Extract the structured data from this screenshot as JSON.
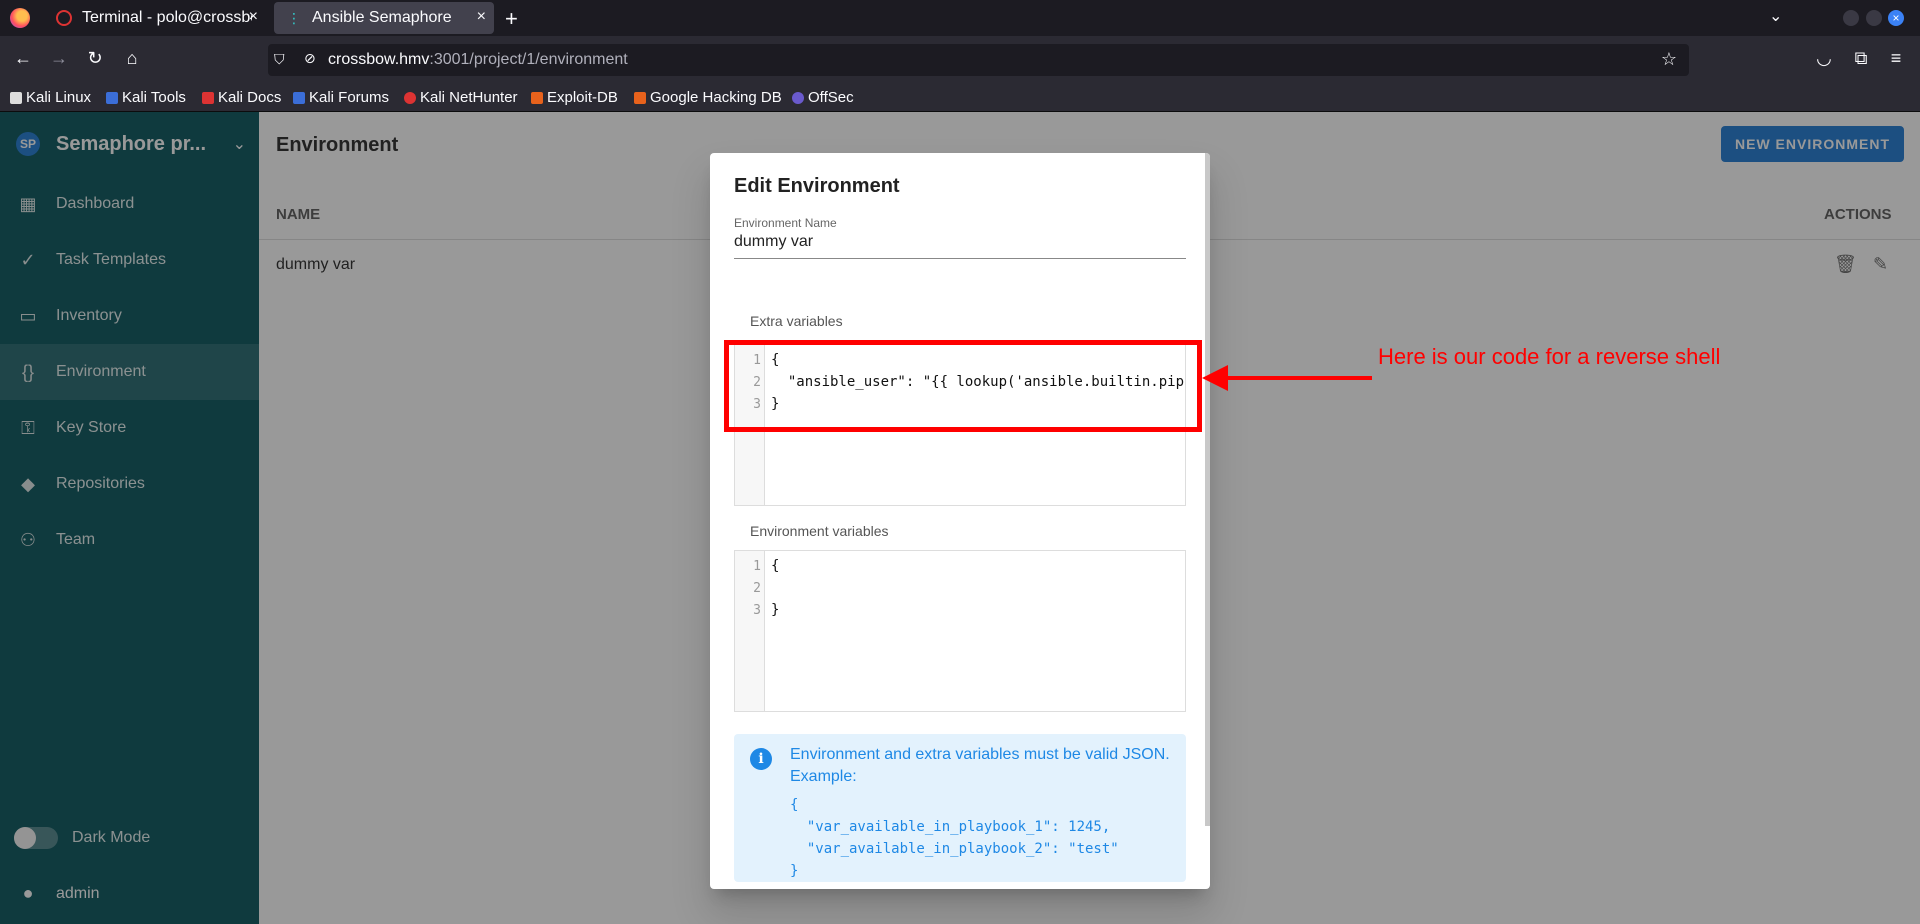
{
  "browser": {
    "tabs": [
      {
        "label": "Terminal - polo@crossbow",
        "close": "×"
      },
      {
        "label": "Ansible Semaphore",
        "close": "×"
      }
    ],
    "new_tab": "+",
    "list_tabs": "⌄",
    "url_host": "crossbow.hmv",
    "url_path": ":3001/project/1/environment",
    "bookmarks": [
      "Kali Linux",
      "Kali Tools",
      "Kali Docs",
      "Kali Forums",
      "Kali NetHunter",
      "Exploit-DB",
      "Google Hacking DB",
      "OffSec"
    ]
  },
  "sidebar": {
    "avatar": "SP",
    "project_name": "Semaphore pr...",
    "items": [
      {
        "label": "Dashboard",
        "icon": "dashboard-icon"
      },
      {
        "label": "Task Templates",
        "icon": "done-all-icon"
      },
      {
        "label": "Inventory",
        "icon": "monitor-icon"
      },
      {
        "label": "Environment",
        "icon": "braces-icon"
      },
      {
        "label": "Key Store",
        "icon": "key-icon"
      },
      {
        "label": "Repositories",
        "icon": "git-icon"
      },
      {
        "label": "Team",
        "icon": "team-icon"
      }
    ],
    "dark_mode": "Dark Mode",
    "user": "admin"
  },
  "main": {
    "title": "Environment",
    "new_button": "NEW ENVIRONMENT",
    "col_name": "NAME",
    "col_actions": "ACTIONS",
    "rows": [
      {
        "name": "dummy var"
      }
    ]
  },
  "dialog": {
    "title": "Edit Environment",
    "name_label": "Environment Name",
    "name_value": "dummy var",
    "extra_label": "Extra variables",
    "extra_lines": [
      "{",
      "  \"ansible_user\": \"{{ lookup('ansible.builtin.pip",
      "}"
    ],
    "env_label": "Environment variables",
    "env_lines": [
      "{",
      "",
      "}"
    ],
    "info_text": "Environment and extra variables must be valid JSON. Example:",
    "info_code": "{\n  \"var_available_in_playbook_1\": 1245,\n  \"var_available_in_playbook_2\": \"test\"\n}"
  },
  "annotation": {
    "text": "Here is our code for a reverse shell",
    "color": "#ff0000"
  },
  "colors": {
    "sidebar_bg": "#005057",
    "primary": "#1976d2",
    "info": "#1e88e5"
  }
}
